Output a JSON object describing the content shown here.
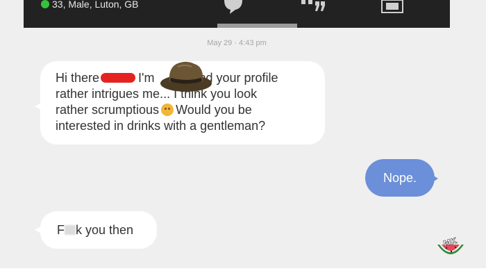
{
  "header": {
    "user_info": "33, Male, Luton, GB",
    "icons": [
      "chat-bubble-icon",
      "quote-icon",
      "gallery-icon"
    ]
  },
  "conversation": {
    "timestamp": "May 29 · 4:43 pm",
    "messages": [
      {
        "direction": "incoming",
        "line1_a": "Hi there",
        "line1_b": "I'm",
        "line1_c": "and your profile",
        "line2": "rather intrigues me... I think you look",
        "line3_a": "rather scrumptious",
        "line3_b": "Would you be",
        "line4": "interested in drinks with a gentleman?"
      },
      {
        "direction": "outgoing",
        "text": "Nope."
      },
      {
        "direction": "incoming",
        "text_a": "F",
        "text_b": "k you then"
      }
    ]
  },
  "watermark": {
    "text": "MK"
  },
  "colors": {
    "header_bg": "#222222",
    "online": "#36c23c",
    "outgoing_bubble": "#6b8fd8",
    "redaction": "#e52222"
  }
}
